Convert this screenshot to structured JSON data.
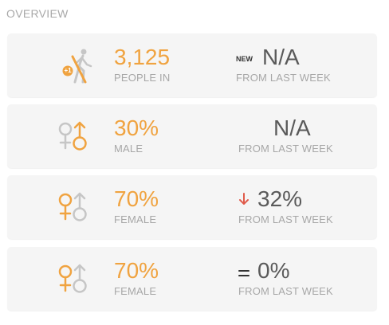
{
  "section_title": "OVERVIEW",
  "colors": {
    "accent": "#f0a340",
    "muted_icon": "#c6c6c6",
    "down": "#e05b4b",
    "text_dark": "#5a5a5a",
    "label": "#a7a7a7",
    "card_bg": "#f5f5f5"
  },
  "cards": [
    {
      "icon": "people-walk-in-icon",
      "badge_text": "+1",
      "metric_value": "3,125",
      "metric_label": "PEOPLE IN",
      "change_prefix": "NEW",
      "change_value": "N/A",
      "change_label": "FROM LAST WEEK"
    },
    {
      "icon": "gender-male-highlight-icon",
      "metric_value": "30%",
      "metric_label": "MALE",
      "change_value": "N/A",
      "change_label": "FROM LAST WEEK"
    },
    {
      "icon": "gender-female-highlight-icon",
      "metric_value": "70%",
      "metric_label": "FEMALE",
      "change_indicator": "down-arrow-icon",
      "change_value": "32%",
      "change_label": "FROM LAST WEEK"
    },
    {
      "icon": "gender-female-highlight-icon",
      "metric_value": "70%",
      "metric_label": "FEMALE",
      "change_indicator": "equals-icon",
      "change_value": "0%",
      "change_label": "FROM LAST WEEK"
    }
  ]
}
